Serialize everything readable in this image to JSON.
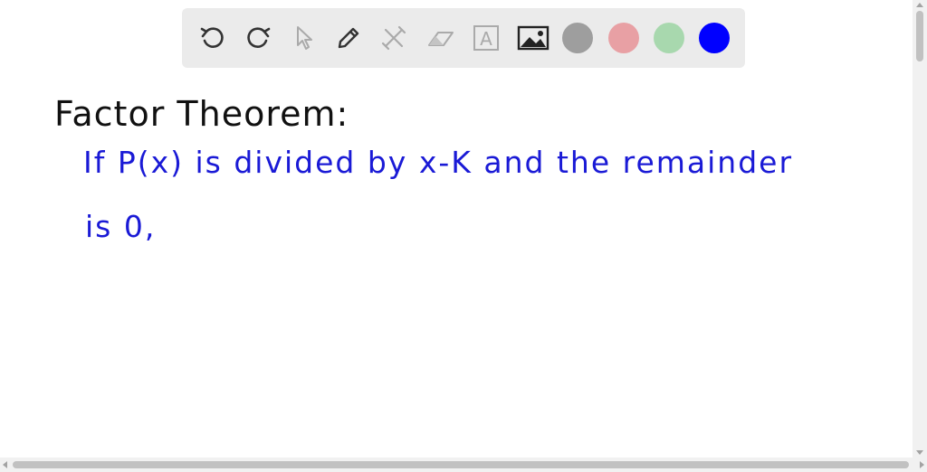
{
  "toolbar": {
    "tools": [
      {
        "icon": "undo-icon"
      },
      {
        "icon": "redo-icon"
      },
      {
        "icon": "select-pointer-icon"
      },
      {
        "icon": "pencil-icon"
      },
      {
        "icon": "tools-icon"
      },
      {
        "icon": "eraser-icon"
      },
      {
        "icon": "text-box-icon",
        "glyph": "A"
      },
      {
        "icon": "image-icon"
      }
    ],
    "colors": [
      {
        "name": "gray",
        "hex": "#9e9e9e"
      },
      {
        "name": "pink",
        "hex": "#e8a0a4"
      },
      {
        "name": "green",
        "hex": "#a8d8ae"
      },
      {
        "name": "blue",
        "hex": "#0000ff",
        "selected": true
      }
    ]
  },
  "canvas": {
    "heading": "Factor Theorem:",
    "line1": "If P(x) is divided by x-K  and the remainder",
    "line2": "is 0,",
    "heading_color": "#111111",
    "ink_color": "#1a1ad6"
  }
}
